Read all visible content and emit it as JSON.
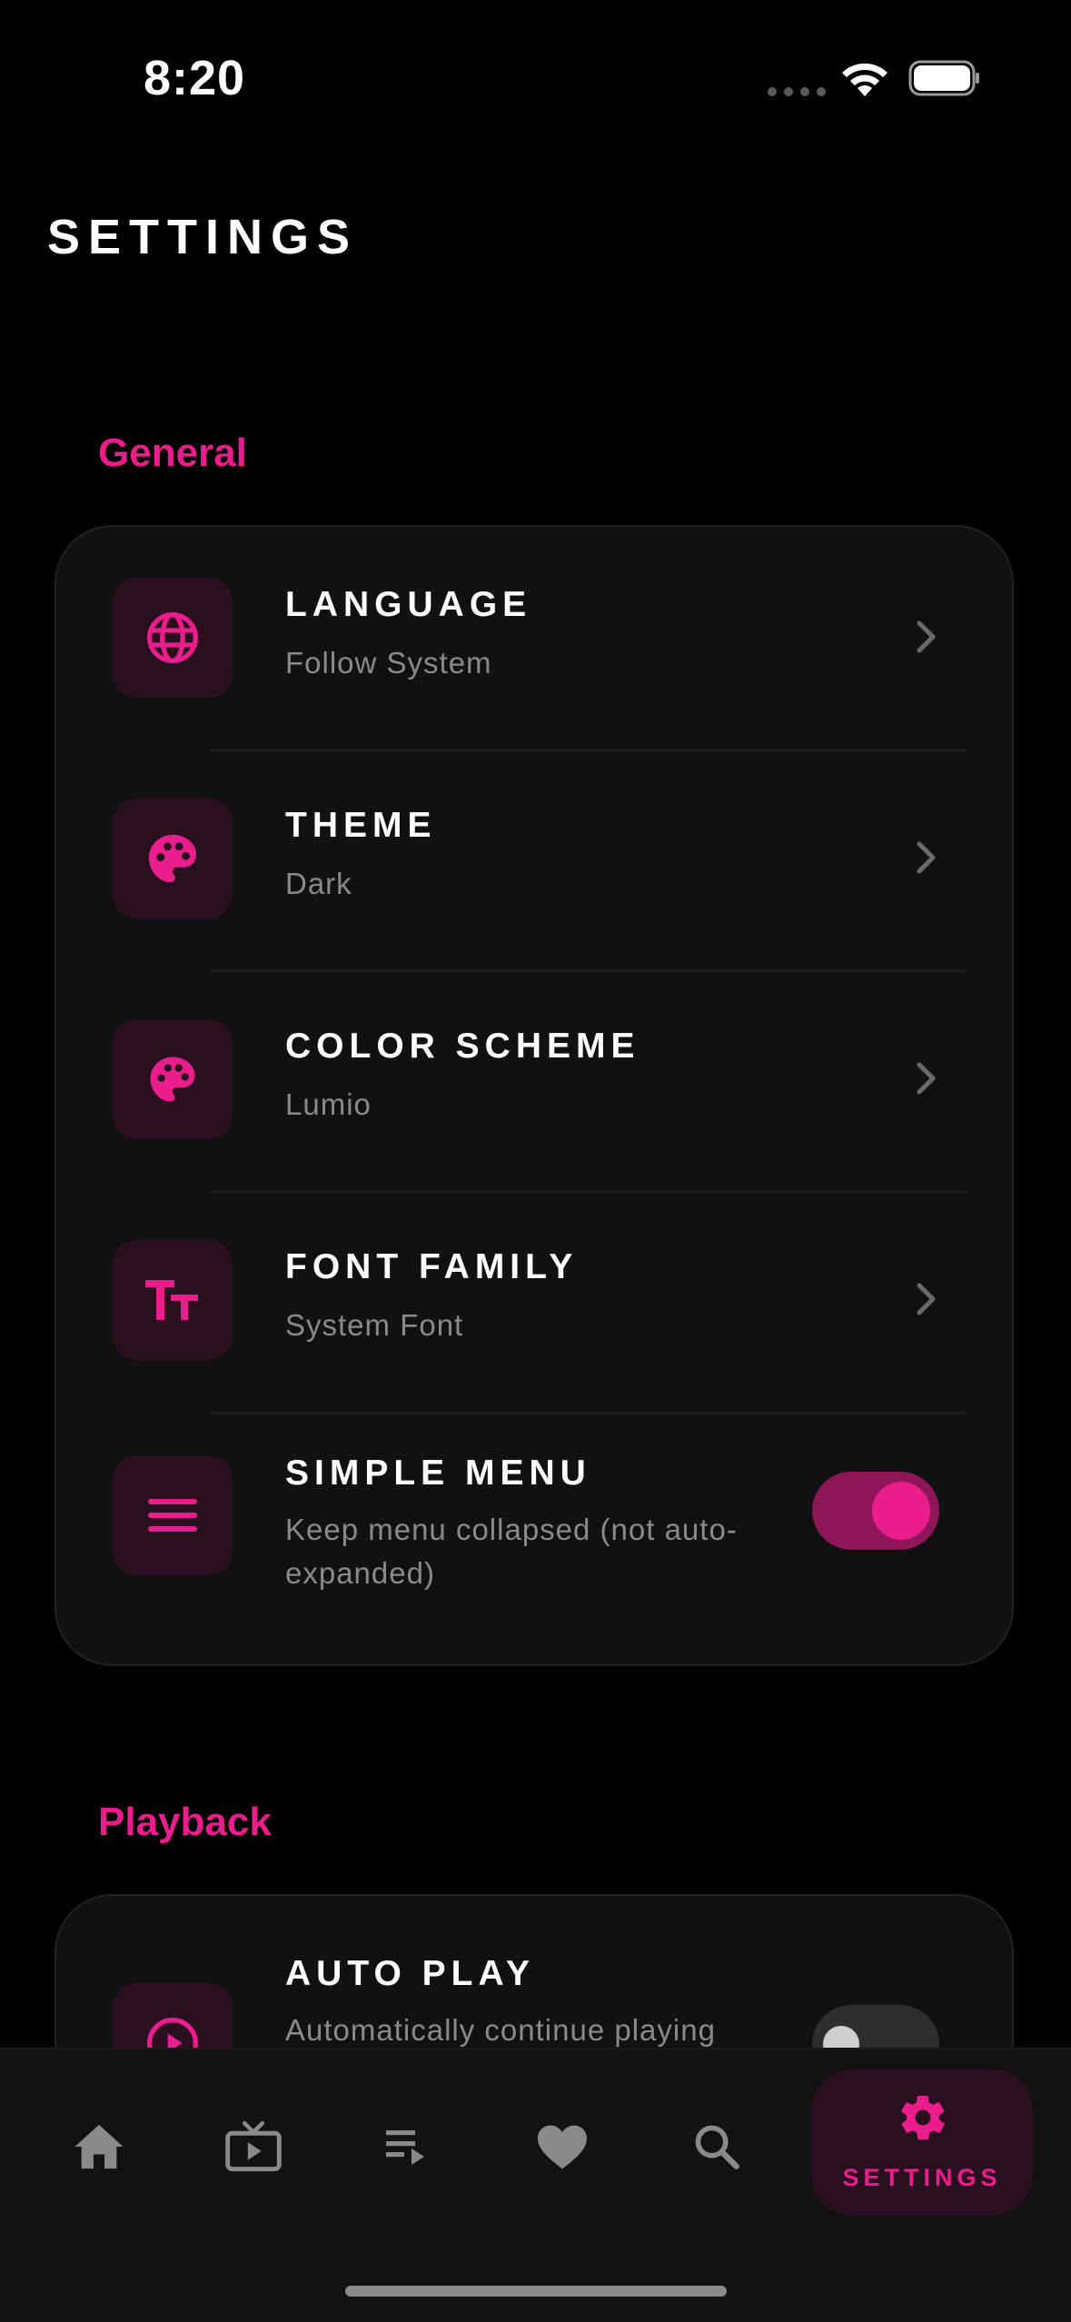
{
  "status_bar": {
    "time": "8:20"
  },
  "header": {
    "title": "SETTINGS"
  },
  "sections": {
    "general": {
      "title": "General",
      "items": [
        {
          "label": "LANGUAGE",
          "value": "Follow System",
          "icon": "globe-icon"
        },
        {
          "label": "THEME",
          "value": "Dark",
          "icon": "palette-icon"
        },
        {
          "label": "COLOR SCHEME",
          "value": "Lumio",
          "icon": "palette-icon"
        },
        {
          "label": "FONT FAMILY",
          "value": "System Font",
          "icon": "text-size-icon"
        },
        {
          "label": "SIMPLE MENU",
          "value": "Keep menu collapsed (not auto-expanded)",
          "icon": "menu-icon",
          "toggle_on": true
        }
      ]
    },
    "playback": {
      "title": "Playback",
      "items": [
        {
          "label": "AUTO PLAY",
          "value": "Automatically continue playing",
          "icon": "play-circle-icon",
          "toggle_on": false
        }
      ]
    }
  },
  "tabbar": {
    "tabs": [
      "home-icon",
      "tv-icon",
      "playlist-icon",
      "heart-icon",
      "search-icon",
      "gear-icon"
    ],
    "active_label": "SETTINGS"
  },
  "colors": {
    "accent": "#e91e8c",
    "accent_dark": "#8e1557",
    "icon_bg": "#2a0f1e",
    "card": "#111111"
  }
}
